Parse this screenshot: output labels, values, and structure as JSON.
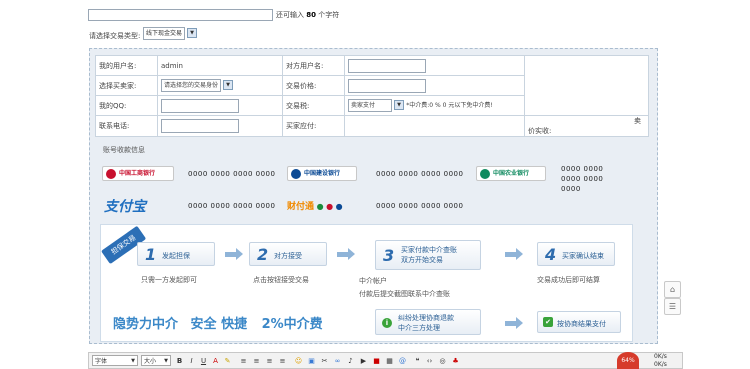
{
  "top": {
    "char_counter_prefix": "还可输入",
    "char_counter_value": "80",
    "char_counter_suffix": "个字符",
    "trade_type_label": "请选择交易类型:",
    "trade_type_value": "线下现金交易"
  },
  "form": {
    "my_user_label": "我的用户名:",
    "my_user_value": "admin",
    "other_user_label": "对方用户名:",
    "role_label": "选择买卖家:",
    "role_value": "请选择您的交易身份",
    "price_label": "交易价格:",
    "qq_label": "我的QQ:",
    "fee_label": "交易税:",
    "fee_select": "卖家支付",
    "fee_note": "*中介费:0 % 0 元以下免中介费!",
    "phone_label": "联系电话:",
    "buyer_pay_label": "买家应付:",
    "seller_get_label": "卖价实收:"
  },
  "accounts": {
    "section_title": "账号收款信息",
    "items": [
      {
        "bank": "中国工商银行",
        "number": "0000 0000 0000 0000",
        "color": "#c8102e"
      },
      {
        "bank": "中国建设银行",
        "number": "0000 0000 0000 0000",
        "color": "#0b4a95"
      },
      {
        "bank": "中国农业银行",
        "number": "0000 0000 0000 0000 0000",
        "color": "#0f8a5f"
      },
      {
        "bank": "支付宝",
        "number": "0000 0000 0000 0000",
        "color": "#1f6fc0"
      },
      {
        "bank": "财付通",
        "number": "0000 0000 0000 0000",
        "color": "#f08a00"
      }
    ]
  },
  "flow": {
    "badge": "担保交易",
    "steps": [
      {
        "num": "1",
        "label": "发起担保",
        "desc": "只需一方发起即可"
      },
      {
        "num": "2",
        "label": "对方接受",
        "desc": "点击按钮接受交易"
      },
      {
        "num": "3",
        "label": "买家付款中介查账\n双方开始交易",
        "desc": "中介帐户\n付款后提交截图联系中介查账"
      },
      {
        "num": "4",
        "label": "买家确认结束",
        "desc": "交易成功后即可结算"
      }
    ],
    "dispute_label": "纠纷处理协商退款\n中介三方处理",
    "dispute_result": "按协商结果支付",
    "slogan_main": "隐势力中介",
    "slogan_tags": "安全 快捷",
    "slogan_fee": "2%中介费"
  },
  "toolbar": {
    "font_label": "字体",
    "size_label": "大小",
    "bold": "B",
    "italic": "I",
    "underline": "U",
    "color": "A"
  },
  "side": {
    "badge_value": "64%",
    "stat1": "0K/s",
    "stat2": "0K/s"
  }
}
